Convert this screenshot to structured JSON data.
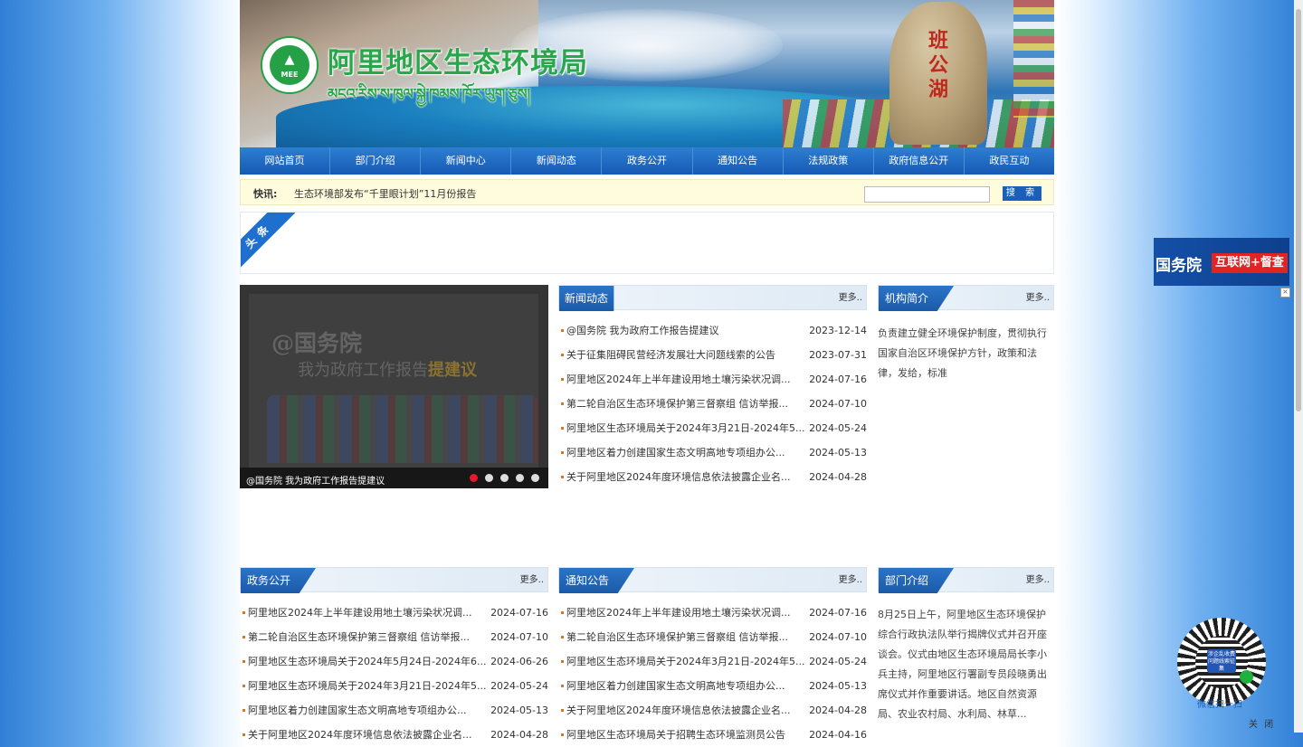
{
  "banner": {
    "site_name": "阿里地区生态环境局",
    "tibetan_name": "མངའ་རིས་ས་ཁུལ་སྐྱེ་ཁམས་ཁོར་ཡུག་ཅུས།",
    "logo_text": "MEE",
    "stone_text": [
      "班",
      "公",
      "湖"
    ]
  },
  "nav": [
    "网站首页",
    "部门介绍",
    "新闻中心",
    "新闻动态",
    "政务公开",
    "通知公告",
    "法规政策",
    "政府信息公开",
    "政民互动"
  ],
  "flash": {
    "label": "快讯:",
    "text": "生态环境部发布“千里眼计划”11月份报告",
    "search_placeholder": "",
    "search_button": "搜 索"
  },
  "headline": {
    "ribbon": "头条"
  },
  "slider": {
    "title": "@国务院",
    "subtitle_a": "我为政府工作报告",
    "subtitle_b": "提建议",
    "caption": "@国务院 我为政府工作报告提建议",
    "dots": 5,
    "active_dot": 1
  },
  "news": {
    "title": "新闻动态",
    "more": "更多..",
    "items": [
      {
        "t": "@国务院 我为政府工作报告提建议",
        "d": "2023-12-14"
      },
      {
        "t": "关于征集阻碍民营经济发展壮大问题线索的公告",
        "d": "2023-07-31"
      },
      {
        "t": "阿里地区2024年上半年建设用地土壤污染状况调...",
        "d": "2024-07-16"
      },
      {
        "t": "第二轮自治区生态环境保护第三督察组 信访举报...",
        "d": "2024-07-10"
      },
      {
        "t": "阿里地区生态环境局关于2024年3月21日-2024年5...",
        "d": "2024-05-24"
      },
      {
        "t": "阿里地区着力创建国家生态文明高地专项组办公...",
        "d": "2024-05-13"
      },
      {
        "t": "关于阿里地区2024年度环境信息依法披露企业名...",
        "d": "2024-04-28"
      }
    ]
  },
  "org": {
    "title": "机构简介",
    "more": "更多..",
    "text": "负责建立健全环境保护制度，贯彻执行国家自治区环境保护方针，政策和法律，发给，标准"
  },
  "gov": {
    "title": "政务公开",
    "more": "更多..",
    "items": [
      {
        "t": "阿里地区2024年上半年建设用地土壤污染状况调...",
        "d": "2024-07-16"
      },
      {
        "t": "第二轮自治区生态环境保护第三督察组 信访举报...",
        "d": "2024-07-10"
      },
      {
        "t": "阿里地区生态环境局关于2024年5月24日-2024年6...",
        "d": "2024-06-26"
      },
      {
        "t": "阿里地区生态环境局关于2024年3月21日-2024年5...",
        "d": "2024-05-24"
      },
      {
        "t": "阿里地区着力创建国家生态文明高地专项组办公...",
        "d": "2024-05-13"
      },
      {
        "t": "关于阿里地区2024年度环境信息依法披露企业名...",
        "d": "2024-04-28"
      }
    ]
  },
  "notice": {
    "title": "通知公告",
    "more": "更多..",
    "items": [
      {
        "t": "阿里地区2024年上半年建设用地土壤污染状况调...",
        "d": "2024-07-16"
      },
      {
        "t": "第二轮自治区生态环境保护第三督察组 信访举报...",
        "d": "2024-07-10"
      },
      {
        "t": "阿里地区生态环境局关于2024年3月21日-2024年5...",
        "d": "2024-05-24"
      },
      {
        "t": "阿里地区着力创建国家生态文明高地专项组办公...",
        "d": "2024-05-13"
      },
      {
        "t": "关于阿里地区2024年度环境信息依法披露企业名...",
        "d": "2024-04-28"
      },
      {
        "t": "阿里地区生态环境局关于招聘生态环境监测员公告",
        "d": "2024-04-16"
      }
    ]
  },
  "dept": {
    "title": "部门介绍",
    "more": "更多..",
    "text": "8月25日上午，阿里地区生态环境保护综合行政执法队举行揭牌仪式并召开座谈会。仪式由地区生态环境局局长李小兵主持，阿里地区行署副专员段晓勇出席仪式并作重要讲话。地区自然资源局、农业农村局、水利局、林草..."
  },
  "float_ad": {
    "left": "国务院",
    "right": "互联网+督查",
    "close": "×"
  },
  "qr": {
    "center": "涉企乱收费问题线索征集",
    "caption": "微信扫一扫",
    "close": "关 闭"
  }
}
